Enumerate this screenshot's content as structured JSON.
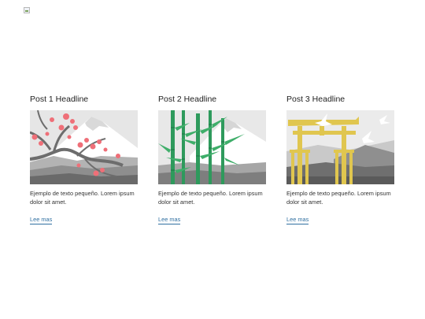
{
  "header": {
    "logo_icon": "broken-image-icon"
  },
  "posts": [
    {
      "title": "Post 1 Headline",
      "image": "cherry-blossom-mountain-illustration",
      "excerpt": "Ejemplo de texto pequeño. Lorem ipsum dolor sit amet.",
      "link_label": "Lee mas"
    },
    {
      "title": "Post 2 Headline",
      "image": "bamboo-mountain-illustration",
      "excerpt": "Ejemplo de texto pequeño. Lorem ipsum dolor sit amet.",
      "link_label": "Lee mas"
    },
    {
      "title": "Post 3 Headline",
      "image": "torii-gate-cranes-illustration",
      "excerpt": "Ejemplo de texto pequeño. Lorem ipsum dolor sit amet.",
      "link_label": "Lee mas"
    }
  ],
  "colors": {
    "link": "#2f6fa0",
    "blossom": "#ef6f78",
    "bamboo": "#2e9a5c",
    "torii": "#e0c64f"
  }
}
